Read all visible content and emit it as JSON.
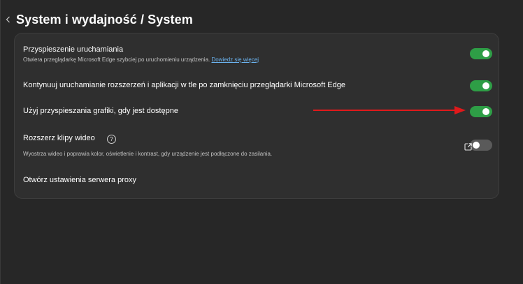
{
  "header": {
    "back_icon": "chevron-left-icon",
    "title": "System i wydajność / System"
  },
  "settings": [
    {
      "title": "Przyspieszenie uruchamiania",
      "description": "Otwiera przeglądarkę Microsoft Edge szybciej po uruchomieniu urządzenia.",
      "link": "Dowiedz się więcej",
      "control": "toggle",
      "state": "on"
    },
    {
      "title": "Kontynuuj uruchamianie rozszerzeń i aplikacji w tle po zamknięciu przeglądarki Microsoft Edge",
      "control": "toggle",
      "state": "on"
    },
    {
      "title": "Użyj przyspieszania grafiki, gdy jest dostępne",
      "control": "toggle",
      "state": "on"
    },
    {
      "title": "Rozszerz klipy wideo",
      "help_icon": "question-circle-icon",
      "help_glyph": "?",
      "description": "Wyostrza wideo i poprawia kolor, oświetlenie i kontrast, gdy urządzenie jest podłączone do zasilania.",
      "control": "toggle",
      "state": "off"
    },
    {
      "title": "Otwórz ustawienia serwera proxy",
      "control": "external-link",
      "icon": "external-link-icon"
    }
  ],
  "annotation": {
    "icon": "red-arrow-icon",
    "color": "#e0191b"
  },
  "colors": {
    "background": "#272727",
    "panel": "#2f2f2f",
    "toggle_on": "#2e9e46",
    "toggle_off": "#5a5a5a",
    "link": "#6cb4f0"
  }
}
